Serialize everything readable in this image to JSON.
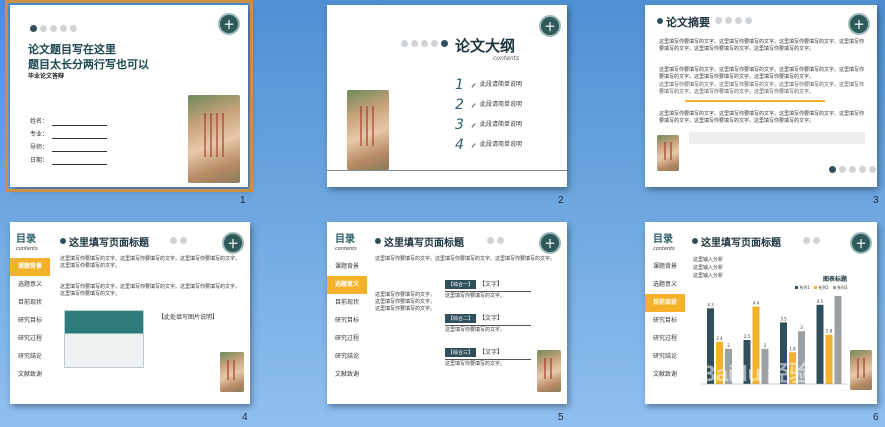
{
  "slides": [
    {
      "number": "1",
      "title_line1": "论文题目写在这里",
      "title_line2": "题目太长分两行写也可以",
      "subtitle": "毕业论文答辩",
      "fields": [
        "姓名：",
        "专业：",
        "导师：",
        "日期："
      ]
    },
    {
      "number": "2",
      "title": "论文大纲",
      "title_en": "contents",
      "items": [
        {
          "n": "1",
          "text": "此段请简单说明"
        },
        {
          "n": "2",
          "text": "此段请简单说明"
        },
        {
          "n": "3",
          "text": "此段请简单说明"
        },
        {
          "n": "4",
          "text": "此段请简单说明"
        }
      ]
    },
    {
      "number": "3",
      "title": "论文摘要",
      "para": "这里填写你要填写的文字。这里填写你要填写的文字。这里填写你要填写的文字。这里填写你要填写的文字。这里填写你要填写的文字。这里填写你要填写的文字。"
    },
    {
      "number": "4",
      "menu_title": "目录",
      "menu_en": "contents",
      "title": "这里填写页面标题",
      "menu": [
        "课题背景",
        "选题意义",
        "目前现状",
        "研究目标",
        "研究过程",
        "研究结论",
        "文献致谢"
      ],
      "active": 0,
      "para": "这里填写你要填写的文字。这里填写你要填写的文字。这里填写你要填写的文字。这里填写你要填写的文字。",
      "img_caption": "【此处填写图片说明】"
    },
    {
      "number": "5",
      "menu_title": "目录",
      "menu_en": "contents",
      "title": "这里填写页面标题",
      "menu": [
        "课题背景",
        "选题意义",
        "目前现状",
        "研究目标",
        "研究过程",
        "研究结论",
        "文献致谢"
      ],
      "active": 1,
      "para": "这里填写你要填写的文字。这里填写你要填写的文字。这里填写你要填写的文字。",
      "boxes": [
        {
          "tag": "【综合一】",
          "label": "【文字】",
          "body": "这里填写你要填写的文字。"
        },
        {
          "tag": "【综合二】",
          "label": "【文字】",
          "body": "这里填写你要填写的文字。"
        },
        {
          "tag": "【综合三】",
          "label": "【文字】",
          "body": "这里填写你要填写的文字。"
        }
      ]
    },
    {
      "number": "6",
      "menu_title": "目录",
      "menu_en": "contents",
      "title": "这里填写页面标题",
      "menu": [
        "课题背景",
        "选题意义",
        "目前现状",
        "研究目标",
        "研究过程",
        "研究结论",
        "文献致谢"
      ],
      "active": 2,
      "analysis": [
        "这里输入分析",
        "这里输入分析",
        "这里输入分析"
      ],
      "chart_title": "图表标题",
      "legend": [
        "系列1",
        "系列2",
        "系列3"
      ]
    }
  ],
  "chart_data": {
    "type": "bar",
    "title": "图表标题",
    "categories": [
      "1",
      "2",
      "3",
      "4"
    ],
    "series": [
      {
        "name": "系列1",
        "values": [
          4.3,
          2.5,
          3.5,
          4.5
        ]
      },
      {
        "name": "系列2",
        "values": [
          2.4,
          4.4,
          1.8,
          2.8
        ]
      },
      {
        "name": "系列3",
        "values": [
          2.0,
          2.0,
          3.0,
          5.0
        ]
      }
    ],
    "ylim": [
      0,
      5
    ]
  },
  "watermark": "Baidu 经验",
  "watermark_url": "jingyan.baidu.com",
  "colors": {
    "dark": "#2f4f5a",
    "accent": "#f3b22a",
    "selection": "#c8914a"
  }
}
